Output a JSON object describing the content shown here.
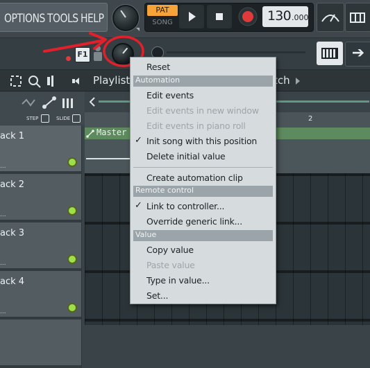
{
  "menu": {
    "options": "OPTIONS",
    "tools": "TOOLS",
    "help": "HELP"
  },
  "transport": {
    "pat_label": "PAT",
    "song_label": "SONG",
    "tempo_int": "130",
    "tempo_frac": ".000"
  },
  "toolbar2": {
    "f1_label": "F1"
  },
  "playlist": {
    "title": "Playlist",
    "title_suffix": "tch",
    "step_label": "STEP",
    "slide_label": "SLIDE",
    "ruler_mark": "2",
    "clip_label": "Master"
  },
  "tracks": [
    {
      "label": "ack 1"
    },
    {
      "label": "ack 2"
    },
    {
      "label": "ack 3"
    },
    {
      "label": "ack 4"
    }
  ],
  "context_menu": {
    "reset": "Reset",
    "section_automation": "Automation",
    "edit_events": "Edit events",
    "edit_events_new_window": "Edit events in new window",
    "edit_events_piano_roll": "Edit events in piano roll",
    "init_song": "Init song with this position",
    "delete_initial": "Delete initial value",
    "create_clip": "Create automation clip",
    "section_remote": "Remote control",
    "link_controller": "Link to controller...",
    "override_link": "Override generic link...",
    "section_value": "Value",
    "copy_value": "Copy value",
    "paste_value": "Paste value",
    "type_value": "Type in value...",
    "set": "Set...",
    "checkmark": "✓"
  },
  "colors": {
    "accent_orange": "#f6a33a",
    "annotation_red": "#e0202a",
    "led_green": "#9ee04a",
    "clip_green": "#5d8a5e"
  },
  "icons": [
    "master-volume-knob-icon",
    "play-icon",
    "stop-icon",
    "record-icon",
    "tempo-gauge-icon",
    "piano-roll-icon",
    "arrow-right-icon",
    "f1-icon",
    "mix-knob-icon",
    "pointer-icon",
    "select-icon",
    "zoom-icon",
    "speaker-icon",
    "checkmark-icon"
  ]
}
